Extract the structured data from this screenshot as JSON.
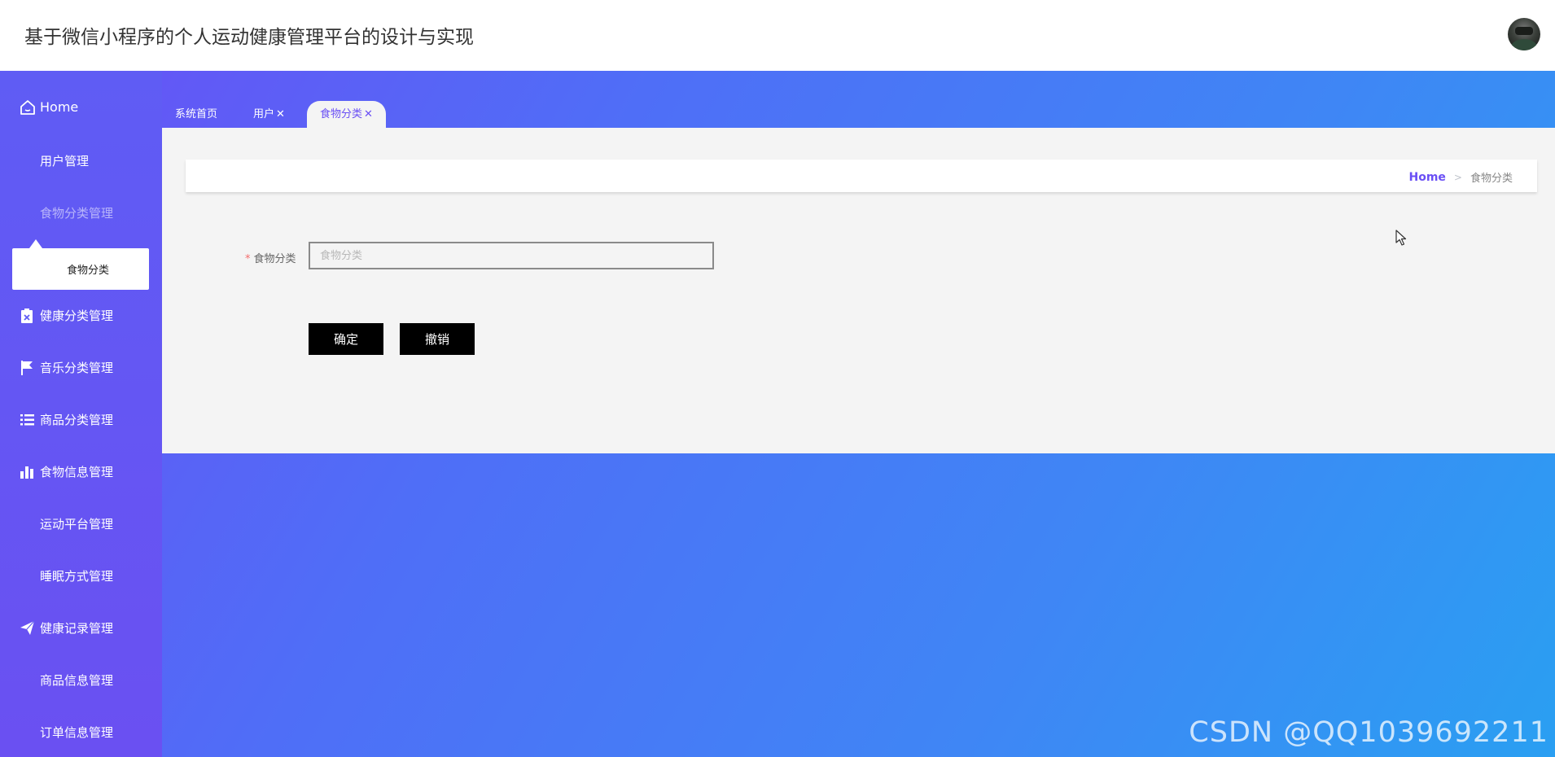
{
  "header": {
    "title": "基于微信小程序的个人运动健康管理平台的设计与实现"
  },
  "sidebar": {
    "items": [
      {
        "label": "Home",
        "icon": "home-icon"
      },
      {
        "label": "用户管理",
        "icon": "grid-icon"
      },
      {
        "label": "食物分类管理",
        "icon": "grid-icon"
      },
      {
        "label": "健康分类管理",
        "icon": "clipboard-icon"
      },
      {
        "label": "音乐分类管理",
        "icon": "flag-icon"
      },
      {
        "label": "商品分类管理",
        "icon": "list-icon"
      },
      {
        "label": "食物信息管理",
        "icon": "bar-chart-icon"
      },
      {
        "label": "运动平台管理",
        "icon": "grid-icon"
      },
      {
        "label": "睡眠方式管理",
        "icon": "grid-icon"
      },
      {
        "label": "健康记录管理",
        "icon": "paper-plane-icon"
      },
      {
        "label": "商品信息管理",
        "icon": "grid-icon"
      },
      {
        "label": "订单信息管理",
        "icon": "grid-nine-icon"
      }
    ],
    "submenu": {
      "items": [
        {
          "label": "食物分类"
        }
      ]
    }
  },
  "tabs": [
    {
      "label": "系统首页",
      "closable": false
    },
    {
      "label": "用户",
      "closable": true
    },
    {
      "label": "食物分类",
      "closable": true,
      "active": true
    }
  ],
  "close_glyph": "✕",
  "breadcrumb": {
    "home": "Home",
    "separator": ">",
    "current": "食物分类"
  },
  "form": {
    "required_mark": "*",
    "label": "食物分类",
    "value": "",
    "placeholder": "食物分类",
    "confirm_label": "确定",
    "cancel_label": "撤销"
  },
  "watermark": "CSDN @QQ1039692211",
  "colors": {
    "accent": "#6a4ff5",
    "gradient_start": "#6a4ff5",
    "gradient_end": "#2a9ff2",
    "button_bg": "#000000",
    "required": "#f56c6c"
  }
}
